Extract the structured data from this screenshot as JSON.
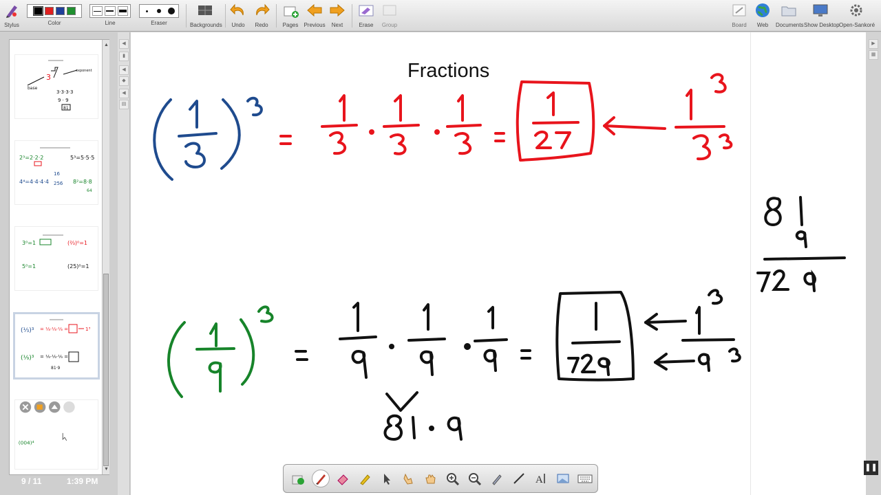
{
  "toolbar": {
    "stylus": "Stylus",
    "color": "Color",
    "line": "Line",
    "eraser": "Eraser",
    "backgrounds": "Backgrounds",
    "undo": "Undo",
    "redo": "Redo",
    "pages": "Pages",
    "previous": "Previous",
    "next": "Next",
    "erase": "Erase",
    "group": "Group",
    "board": "Board",
    "web": "Web",
    "documents": "Documents",
    "show_desktop": "Show Desktop",
    "open_sankore": "Open-Sankoré",
    "color_swatches": [
      "#000000",
      "#e02020",
      "#1f3f9a",
      "#1f8f2f"
    ]
  },
  "sidebar": {
    "page_indicator": "9 / 11",
    "clock": "1:39 PM"
  },
  "canvas": {
    "title": "Fractions",
    "ink_colors": {
      "blue": "#1f4b8e",
      "red": "#e8141c",
      "green": "#17842a",
      "black": "#111111"
    }
  },
  "palette": {
    "tools": [
      "color-picker-icon",
      "pen-icon",
      "eraser-icon",
      "highlighter-icon",
      "pointer-icon",
      "laser-hand-icon",
      "hand-icon",
      "zoom-in-icon",
      "zoom-out-icon",
      "capture-pen-icon",
      "line-icon",
      "text-icon",
      "capture-icon",
      "keyboard-icon"
    ]
  }
}
